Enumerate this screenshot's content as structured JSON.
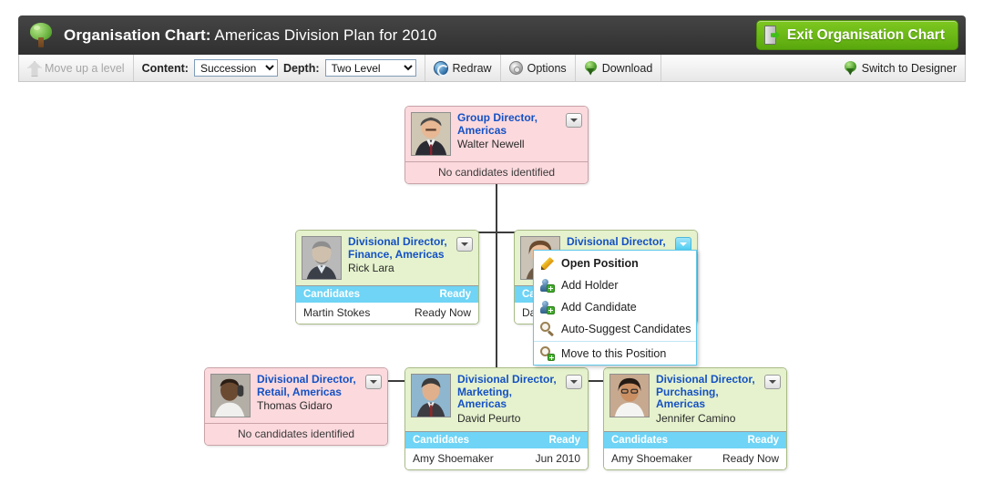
{
  "header": {
    "icon": "tree-icon",
    "title_strong": "Organisation Chart:",
    "title_sub": " Americas Division Plan for 2010",
    "exit_button_label": "Exit Organisation Chart",
    "exit_button_icon": "exit-door-icon",
    "accent_green": "#6fbd16",
    "bar_color": "#3a3a3a"
  },
  "toolbar": {
    "move_up_label": "Move up a level",
    "move_up_icon": "up-arrow-icon",
    "content_label": "Content:",
    "content_value": "Succession",
    "content_options": [
      "Succession"
    ],
    "depth_label": "Depth:",
    "depth_value": "Two Level",
    "depth_options": [
      "Two Level"
    ],
    "redraw_label": "Redraw",
    "redraw_icon": "redraw-icon",
    "options_label": "Options",
    "options_icon": "gear-icon",
    "download_label": "Download",
    "download_icon": "globe-download-icon",
    "switch_label": "Switch to Designer",
    "switch_icon": "globe-designer-icon"
  },
  "chart": {
    "candidates_col_label": "Candidates",
    "ready_col_label": "Ready",
    "no_candidates_label": "No candidates identified",
    "header_bar_color": "#6fd4f5",
    "pink_card_color": "#fbd9dd",
    "green_card_color": "#e5f2cd",
    "nodes": {
      "root": {
        "role": "Group Director, Americas",
        "person": "Walter Newell",
        "status": "No candidates identified",
        "color": "pink"
      },
      "finance": {
        "role": "Divisional Director, Finance, Americas",
        "person": "Rick Lara",
        "color": "green",
        "candidate_name": "Martin Stokes",
        "candidate_ready": "Ready Now"
      },
      "hr": {
        "role": "Divisional Director, HR, Americas",
        "person": "Da",
        "color": "green",
        "candidate_name": "Da",
        "candidate_ready": ""
      },
      "retail": {
        "role": "Divisional Director, Retail, Americas",
        "person": "Thomas Gidaro",
        "status": "No candidates identified",
        "color": "pink"
      },
      "marketing": {
        "role": "Divisional Director, Marketing, Americas",
        "person": "David Peurto",
        "color": "green",
        "candidate_name": "Amy Shoemaker",
        "candidate_ready": "Jun 2010"
      },
      "purchasing": {
        "role": "Divisional Director, Purchasing, Americas",
        "person": "Jennifer Camino",
        "color": "green",
        "candidate_name": "Amy Shoemaker",
        "candidate_ready": "Ready Now"
      }
    }
  },
  "context_menu": {
    "items": [
      {
        "label": "Open Position",
        "icon": "pencil-icon",
        "bold": true
      },
      {
        "label": "Add Holder",
        "icon": "add-person-icon",
        "bold": false
      },
      {
        "label": "Add Candidate",
        "icon": "add-person-icon",
        "bold": false
      },
      {
        "label": "Auto-Suggest Candidates",
        "icon": "magnifier-icon",
        "bold": false
      },
      {
        "label": "Move to this Position",
        "icon": "magnifier-move-icon",
        "bold": false
      }
    ]
  }
}
